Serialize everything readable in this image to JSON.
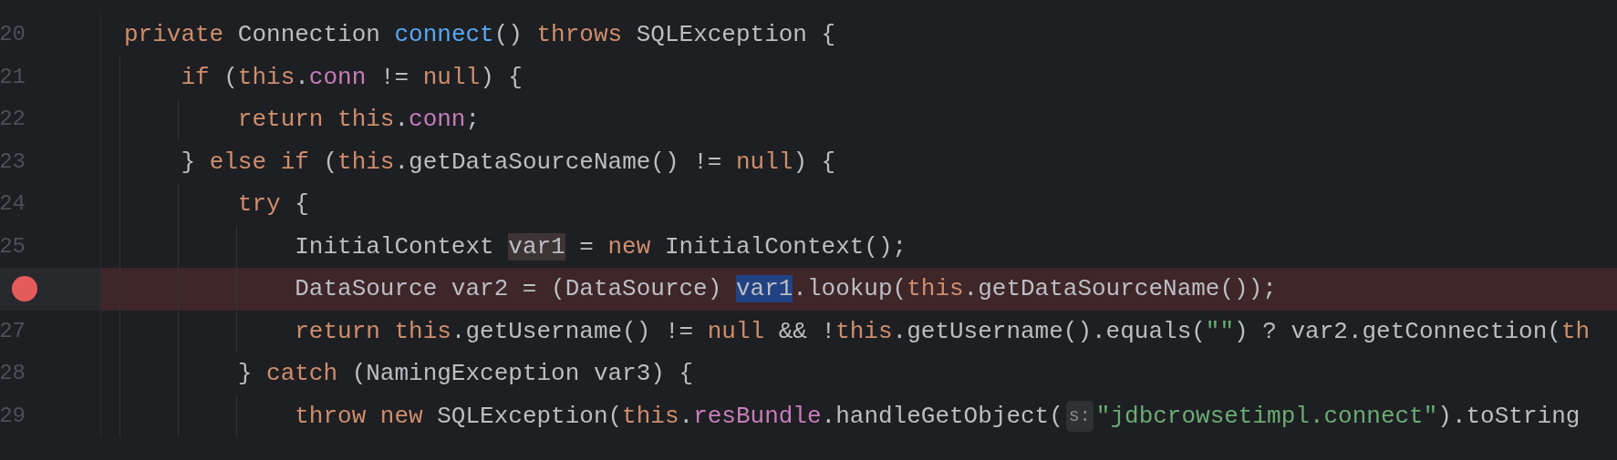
{
  "editor": {
    "lines": [
      {
        "number": "20",
        "breakpoint": false,
        "tokens": [
          {
            "kind": "keyword",
            "text": "private "
          },
          {
            "kind": "plain",
            "text": "Connection "
          },
          {
            "kind": "method",
            "text": "connect"
          },
          {
            "kind": "plain",
            "text": "() "
          },
          {
            "kind": "keyword",
            "text": "throws "
          },
          {
            "kind": "plain",
            "text": "SQLException {"
          }
        ]
      },
      {
        "number": "21",
        "breakpoint": false,
        "tokens": [
          {
            "kind": "keyword",
            "text": "    if "
          },
          {
            "kind": "plain",
            "text": "("
          },
          {
            "kind": "keyword",
            "text": "this"
          },
          {
            "kind": "plain",
            "text": "."
          },
          {
            "kind": "field",
            "text": "conn"
          },
          {
            "kind": "plain",
            "text": " != "
          },
          {
            "kind": "keyword",
            "text": "null"
          },
          {
            "kind": "plain",
            "text": ") {"
          }
        ]
      },
      {
        "number": "22",
        "breakpoint": false,
        "tokens": [
          {
            "kind": "keyword",
            "text": "        return this"
          },
          {
            "kind": "plain",
            "text": "."
          },
          {
            "kind": "field",
            "text": "conn"
          },
          {
            "kind": "plain",
            "text": ";"
          }
        ]
      },
      {
        "number": "23",
        "breakpoint": false,
        "tokens": [
          {
            "kind": "plain",
            "text": "    } "
          },
          {
            "kind": "keyword",
            "text": "else if "
          },
          {
            "kind": "plain",
            "text": "("
          },
          {
            "kind": "keyword",
            "text": "this"
          },
          {
            "kind": "plain",
            "text": ".getDataSourceName() != "
          },
          {
            "kind": "keyword",
            "text": "null"
          },
          {
            "kind": "plain",
            "text": ") {"
          }
        ]
      },
      {
        "number": "24",
        "breakpoint": false,
        "tokens": [
          {
            "kind": "keyword",
            "text": "        try "
          },
          {
            "kind": "plain",
            "text": "{"
          }
        ]
      },
      {
        "number": "25",
        "breakpoint": false,
        "tokens": [
          {
            "kind": "plain",
            "text": "            InitialContext "
          },
          {
            "kind": "usage",
            "text": "var1"
          },
          {
            "kind": "plain",
            "text": " = "
          },
          {
            "kind": "keyword",
            "text": "new "
          },
          {
            "kind": "plain",
            "text": "InitialContext();"
          }
        ]
      },
      {
        "breakpoint": true,
        "tokens": [
          {
            "kind": "plain",
            "text": "            DataSource var2 = (DataSource) "
          },
          {
            "kind": "selection",
            "text": "var1"
          },
          {
            "kind": "plain",
            "text": ".lookup("
          },
          {
            "kind": "keyword",
            "text": "this"
          },
          {
            "kind": "plain",
            "text": ".getDataSourceName());"
          }
        ]
      },
      {
        "number": "27",
        "breakpoint": false,
        "tokens": [
          {
            "kind": "keyword",
            "text": "            return this"
          },
          {
            "kind": "plain",
            "text": ".getUsername() != "
          },
          {
            "kind": "keyword",
            "text": "null"
          },
          {
            "kind": "plain",
            "text": " && !"
          },
          {
            "kind": "keyword",
            "text": "this"
          },
          {
            "kind": "plain",
            "text": ".getUsername().equals("
          },
          {
            "kind": "string",
            "text": "\"\""
          },
          {
            "kind": "plain",
            "text": ") ? var2.getConnection("
          },
          {
            "kind": "keyword",
            "text": "th"
          }
        ]
      },
      {
        "number": "28",
        "breakpoint": false,
        "tokens": [
          {
            "kind": "plain",
            "text": "        } "
          },
          {
            "kind": "keyword",
            "text": "catch "
          },
          {
            "kind": "plain",
            "text": "(NamingException var3) {"
          }
        ]
      },
      {
        "number": "29",
        "breakpoint": false,
        "tokens": [
          {
            "kind": "keyword",
            "text": "            throw new "
          },
          {
            "kind": "plain",
            "text": "SQLException("
          },
          {
            "kind": "keyword",
            "text": "this"
          },
          {
            "kind": "plain",
            "text": "."
          },
          {
            "kind": "field",
            "text": "resBundle"
          },
          {
            "kind": "plain",
            "text": ".handleGetObject("
          },
          {
            "kind": "hint",
            "text": "s:"
          },
          {
            "kind": "string",
            "text": "\"jdbcrowsetimpl.connect\""
          },
          {
            "kind": "plain",
            "text": ").toString"
          }
        ]
      }
    ]
  }
}
